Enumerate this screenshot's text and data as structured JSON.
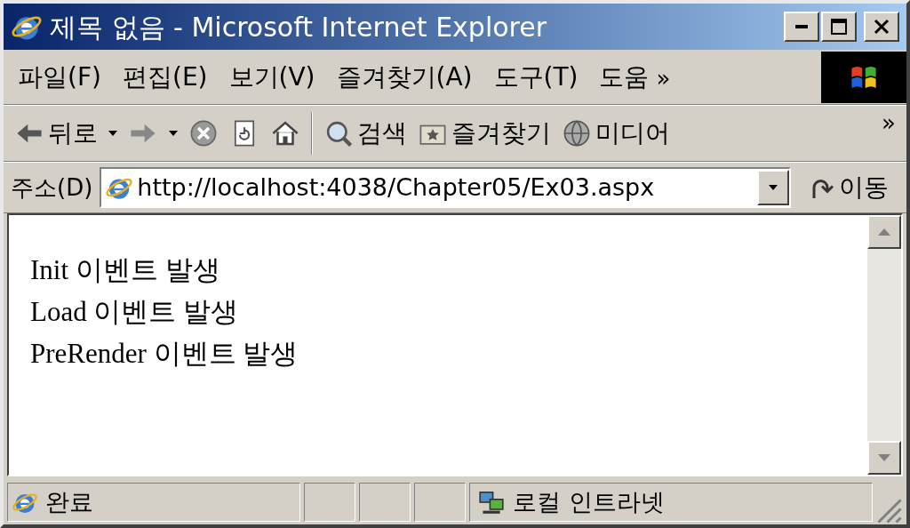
{
  "window": {
    "title": "제목 없음 - Microsoft Internet Explorer"
  },
  "menu": [
    "파일(F)",
    "편집(E)",
    "보기(V)",
    "즐겨찾기(A)",
    "도구(T)",
    "도움"
  ],
  "menu_more": "»",
  "toolbar": [
    {
      "kind": "back",
      "label": "뒤로"
    },
    {
      "kind": "forward"
    },
    {
      "kind": "stop"
    },
    {
      "kind": "refresh"
    },
    {
      "kind": "home"
    },
    {
      "kind": "search",
      "label": "검색"
    },
    {
      "kind": "favorites",
      "label": "즐겨찾기"
    },
    {
      "kind": "media",
      "label": "미디어"
    }
  ],
  "toolbar_more": "»",
  "address": {
    "label": "주소(D)",
    "value": "http://localhost:4038/Chapter05/Ex03.aspx",
    "go": "이동"
  },
  "content": [
    "Init 이벤트 발생",
    "Load 이벤트 발생",
    "PreRender 이벤트 발생"
  ],
  "status_bar": {
    "text": "완료",
    "zone": "로컬 인트라넷"
  }
}
